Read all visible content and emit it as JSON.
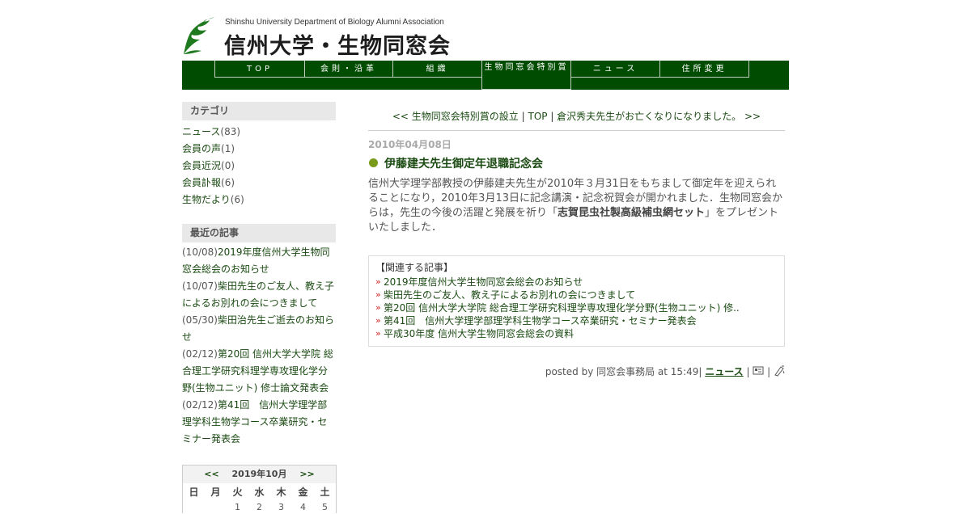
{
  "header": {
    "subtitle": "Shinshu University Department of Biology Alumni Association",
    "title": "信州大学・生物同窓会"
  },
  "nav": [
    "TOP",
    "会則・沿革",
    "組織",
    "生物同窓会特別賞",
    "ニュース",
    "住所変更"
  ],
  "sidebar": {
    "categories_heading": "カテゴリ",
    "categories": [
      {
        "label": "ニュース",
        "count": "(83)"
      },
      {
        "label": "会員の声",
        "count": "(1)"
      },
      {
        "label": "会員近況",
        "count": "(0)"
      },
      {
        "label": "会員訃報",
        "count": "(6)"
      },
      {
        "label": "生物だより",
        "count": "(6)"
      }
    ],
    "recent_heading": "最近の記事",
    "recent": [
      {
        "date": "(10/08)",
        "title": "2019年度信州大学生物同窓会総会のお知らせ"
      },
      {
        "date": "(10/07)",
        "title": "柴田先生のご友人、教え子によるお別れの会につきまして"
      },
      {
        "date": "(05/30)",
        "title": "柴田治先生ご逝去のお知らせ"
      },
      {
        "date": "(02/12)",
        "title": "第20回 信州大学大学院 総合理工学研究科理学専攻理化学分野(生物ユニット) 修士論文発表会"
      },
      {
        "date": "(02/12)",
        "title": "第41回　信州大学理学部理学科生物学コース卒業研究・セミナー発表会"
      }
    ],
    "calendar": {
      "prev": "<<",
      "month": "2019年10月",
      "next": ">>",
      "days": [
        "日",
        "月",
        "火",
        "水",
        "木",
        "金",
        "土"
      ],
      "first_row": [
        "",
        "",
        "1",
        "2",
        "3",
        "4",
        "5"
      ]
    }
  },
  "main": {
    "pager": {
      "prev": "<< 生物同窓会特別賞の設立",
      "sep1": " | ",
      "top": "TOP",
      "sep2": " | ",
      "next": "倉沢秀夫先生がお亡くなりになりました。 >>"
    },
    "date": "2010年04月08日",
    "title": "伊藤建夫先生御定年退職記念会",
    "body_before": "信州大学理学部教授の伊藤建夫先生が2010年３月31日をもちまして御定年を迎えられることになり，2010年3月13日に記念講演・記念祝賀会が開かれました．生物同窓会からは，先生の今後の活躍と発展を祈り「",
    "body_bold": "志賀昆虫社製高級補虫網セット",
    "body_after": "」をプレゼントいたしました．",
    "related_heading": "【関連する記事】",
    "related": [
      "2019年度信州大学生物同窓会総会のお知らせ",
      "柴田先生のご友人、教え子によるお別れの会につきまして",
      "第20回 信州大学大学院 総合理工学研究科理学専攻理化学分野(生物ユニット) 修..",
      "第41回　信州大学理学部理学科生物学コース卒業研究・セミナー発表会",
      "平成30年度 信州大学生物同窓会総会の資料"
    ],
    "posted_prefix": "posted by 同窓会事務局 at 15:49| ",
    "posted_category": "ニュース",
    "posted_sep": " | ",
    "posted_sep2": " | "
  },
  "colors": {
    "nav_bg": "#004c00",
    "link": "#1a4a12",
    "bullet": "#7a9a1a",
    "sidebar_head_bg": "#e8e8e8"
  }
}
